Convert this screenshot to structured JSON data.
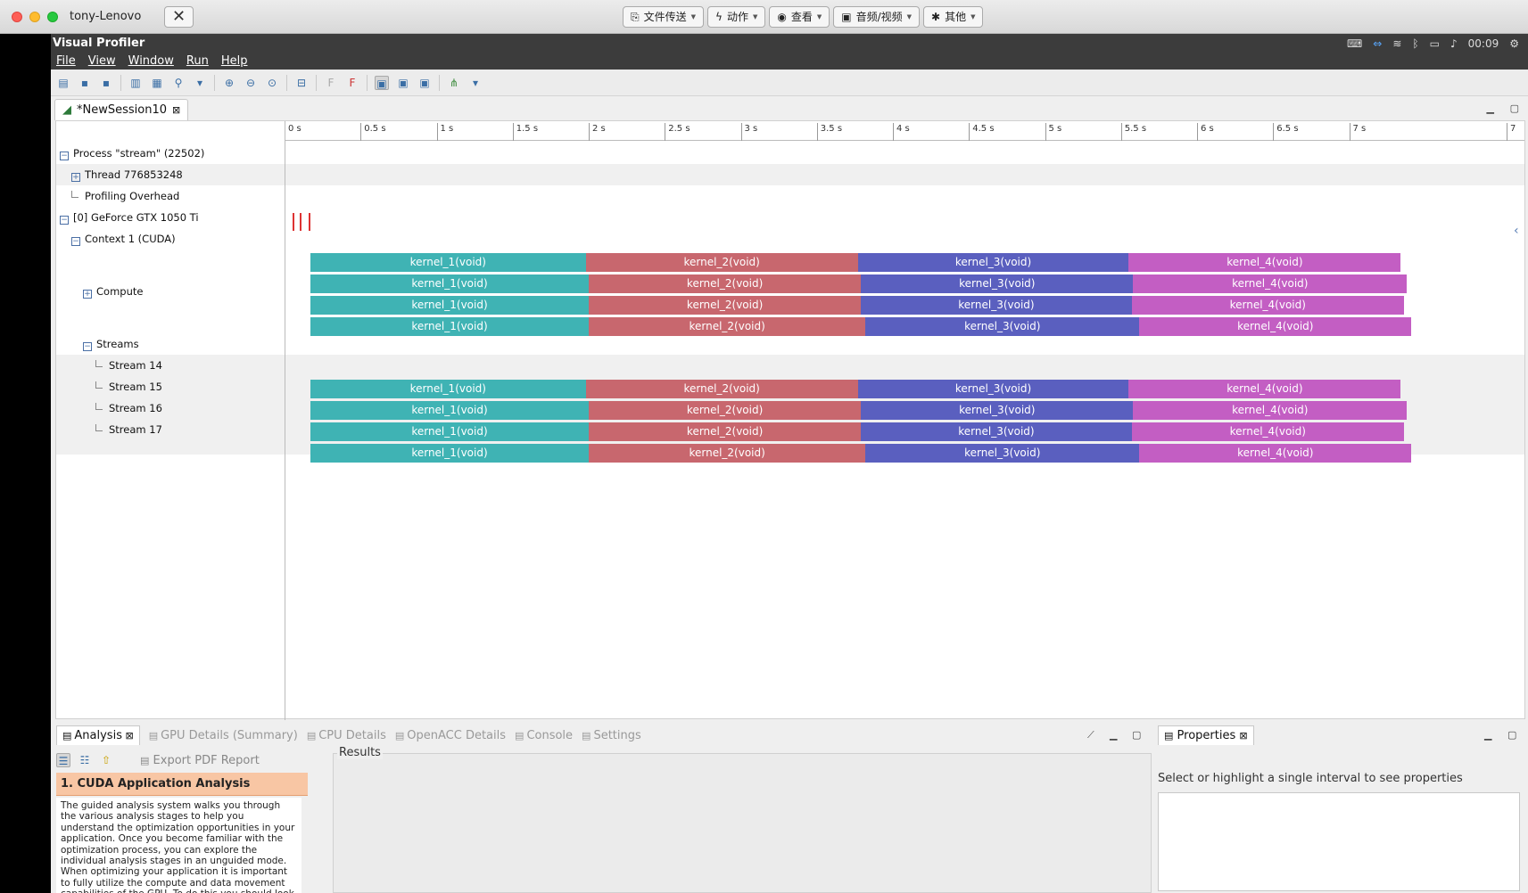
{
  "mac": {
    "window_title": "tony-Lenovo",
    "close_glyph": "✕",
    "buttons": [
      {
        "icon": "file-transfer-icon",
        "glyph": "⎘",
        "label": "文件传送"
      },
      {
        "icon": "lightning-icon",
        "glyph": "ϟ",
        "label": "动作"
      },
      {
        "icon": "eye-icon",
        "glyph": "◉",
        "label": "查看"
      },
      {
        "icon": "chat-icon",
        "glyph": "▣",
        "label": "音频/视频"
      },
      {
        "icon": "puzzle-icon",
        "glyph": "✱",
        "label": "其他"
      }
    ]
  },
  "app": {
    "title": "Visual Profiler",
    "clock": "00:09",
    "menu": [
      "File",
      "View",
      "Window",
      "Run",
      "Help"
    ]
  },
  "session_tab": {
    "label": "*NewSession10",
    "close_glyph": "⊠"
  },
  "timeline": {
    "ticks": [
      "0 s",
      "0.5 s",
      "1 s",
      "1.5 s",
      "2 s",
      "2.5 s",
      "3 s",
      "3.5 s",
      "4 s",
      "4.5 s",
      "5 s",
      "5.5 s",
      "6 s",
      "6.5 s",
      "7 s",
      "7"
    ],
    "rows": [
      {
        "label": "Process \"stream\" (22502)",
        "expander": "−",
        "indent": 0
      },
      {
        "label": "Thread 776853248",
        "expander": "+",
        "indent": 1
      },
      {
        "label": "Profiling Overhead",
        "expander": "",
        "indent": 1
      },
      {
        "label": "[0] GeForce GTX 1050 Ti",
        "expander": "−",
        "indent": 0
      },
      {
        "label": "Context 1 (CUDA)",
        "expander": "−",
        "indent": 1
      },
      {
        "label": "Compute",
        "expander": "+",
        "indent": 2
      },
      {
        "label": "Streams",
        "expander": "−",
        "indent": 2
      },
      {
        "label": "Stream 14",
        "expander": "",
        "indent": 3
      },
      {
        "label": "Stream 15",
        "expander": "",
        "indent": 3
      },
      {
        "label": "Stream 16",
        "expander": "",
        "indent": 3
      },
      {
        "label": "Stream 17",
        "expander": "",
        "indent": 3
      }
    ],
    "kernel_colors": [
      "#3fb3b4",
      "#c8676e",
      "#5a5fbf",
      "#c35ec3"
    ],
    "kernel_names": [
      "kernel_1(void)",
      "kernel_2(void)",
      "kernel_3(void)",
      "kernel_4(void)"
    ],
    "kernel_lanes_seconds": [
      [
        0.17,
        1.98,
        3.77,
        5.55,
        7.34
      ],
      [
        0.17,
        2.0,
        3.79,
        5.58,
        7.38
      ],
      [
        0.17,
        2.0,
        3.79,
        5.57,
        7.36
      ],
      [
        0.17,
        2.0,
        3.82,
        5.62,
        7.41
      ]
    ]
  },
  "bottom": {
    "tabs": [
      {
        "label": "Analysis",
        "active": true
      },
      {
        "label": "GPU Details (Summary)",
        "active": false
      },
      {
        "label": "CPU Details",
        "active": false
      },
      {
        "label": "OpenACC Details",
        "active": false
      },
      {
        "label": "Console",
        "active": false
      },
      {
        "label": "Settings",
        "active": false
      }
    ],
    "export_label": "Export PDF Report",
    "section_title": "1. CUDA Application Analysis",
    "section_text": "The guided analysis system walks you through the various analysis stages to help you understand the optimization opportunities in your application. Once you become familiar with the optimization process, you can explore the individual analysis stages in an unguided mode. When optimizing your application it is important to fully utilize the compute and data movement capabilities of the GPU. To do this you should look at your application's overall GPU usage as well as the performance of individual kernels.",
    "results_label": "Results"
  },
  "properties": {
    "tab_label": "Properties",
    "hint": "Select or highlight a single interval to see properties"
  }
}
